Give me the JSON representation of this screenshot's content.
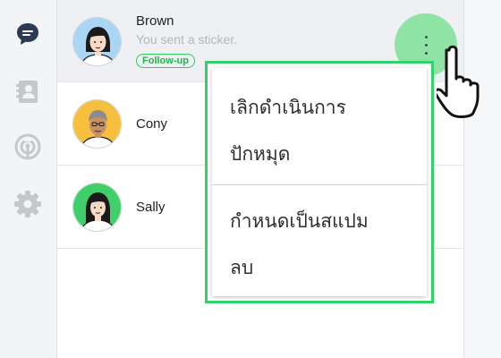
{
  "nav": {
    "items": [
      {
        "icon": "chat-bubble-icon",
        "active": true
      },
      {
        "icon": "contacts-icon",
        "active": false
      },
      {
        "icon": "broadcast-icon",
        "active": false
      },
      {
        "icon": "gear-icon",
        "active": false
      }
    ]
  },
  "chats": [
    {
      "name": "Brown",
      "preview": "You sent a sticker.",
      "badge": "Follow-up",
      "selected": true
    },
    {
      "name": "Cony"
    },
    {
      "name": "Sally"
    }
  ],
  "more_button": {
    "icon": "more-vertical-icon"
  },
  "context_menu": {
    "items": [
      {
        "label": "เลิกดำเนินการ"
      },
      {
        "label": "ปักหมุด"
      },
      {
        "label": "กำหนดเป็นสแปม"
      },
      {
        "label": "ลบ"
      }
    ]
  },
  "colors": {
    "accent_green": "#2fd36a",
    "highlight_green": "#8fe3a4",
    "rail_icon": "#c4c8cc",
    "active_icon": "#2b3a55"
  }
}
